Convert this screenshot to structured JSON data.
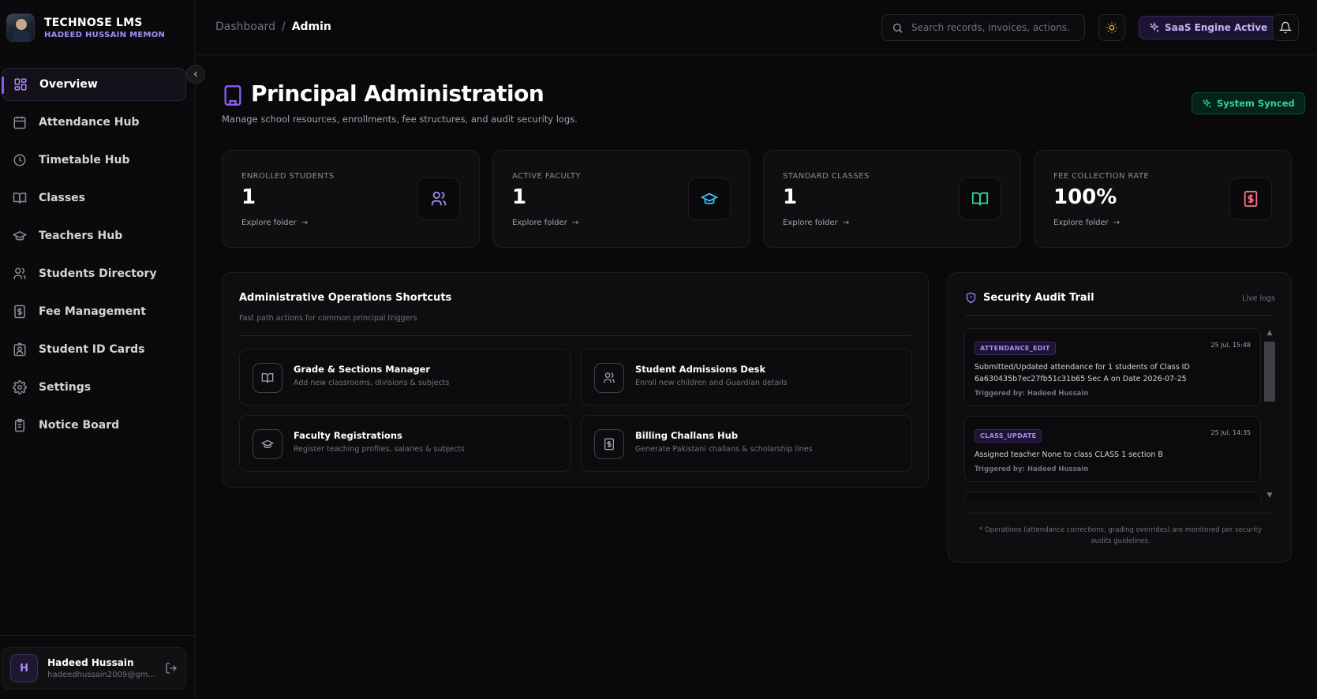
{
  "brand": {
    "title": "TECHNOSE LMS",
    "subtitle": "HADEED HUSSAIN MEMON"
  },
  "sidebar": {
    "items": [
      {
        "label": "Overview",
        "icon": "dashboard-icon",
        "active": true
      },
      {
        "label": "Attendance Hub",
        "icon": "calendar-icon"
      },
      {
        "label": "Timetable Hub",
        "icon": "clock-icon"
      },
      {
        "label": "Classes",
        "icon": "book-open-icon"
      },
      {
        "label": "Teachers Hub",
        "icon": "graduation-cap-icon"
      },
      {
        "label": "Students Directory",
        "icon": "users-icon"
      },
      {
        "label": "Fee Management",
        "icon": "receipt-icon"
      },
      {
        "label": "Student ID Cards",
        "icon": "id-badge-icon"
      },
      {
        "label": "Settings",
        "icon": "gear-icon"
      },
      {
        "label": "Notice Board",
        "icon": "clipboard-icon"
      }
    ],
    "user": {
      "initial": "H",
      "name": "Hadeed Hussain",
      "email": "hadeedhussain2009@gm..."
    }
  },
  "header": {
    "breadcrumb": [
      "Dashboard",
      "/",
      "Admin"
    ],
    "search_placeholder": "Search records, invoices, actions...",
    "saas_badge": "SaaS Engine Active"
  },
  "page": {
    "title": "Principal Administration",
    "description": "Manage school resources, enrollments, fee structures, and audit security logs.",
    "sync_badge": "System Synced"
  },
  "stats": [
    {
      "label": "ENROLLED STUDENTS",
      "value": "1",
      "link": "Explore folder",
      "icon": "users-icon",
      "color": "#a78bfa"
    },
    {
      "label": "ACTIVE FACULTY",
      "value": "1",
      "link": "Explore folder",
      "icon": "graduation-cap-icon",
      "color": "#38bdf8"
    },
    {
      "label": "STANDARD CLASSES",
      "value": "1",
      "link": "Explore folder",
      "icon": "book-open-icon",
      "color": "#34d399"
    },
    {
      "label": "FEE COLLECTION RATE",
      "value": "100%",
      "link": "Explore folder",
      "icon": "receipt-icon",
      "color": "#fb7185"
    }
  ],
  "shortcuts": {
    "title": "Administrative Operations Shortcuts",
    "subtitle": "Fast path actions for common principal triggers",
    "items": [
      {
        "title": "Grade & Sections Manager",
        "desc": "Add new classrooms, divisions & subjects",
        "icon": "book-open-icon"
      },
      {
        "title": "Student Admissions Desk",
        "desc": "Enroll new children and Guardian details",
        "icon": "users-icon"
      },
      {
        "title": "Faculty Registrations",
        "desc": "Register teaching profiles, salaries & subjects",
        "icon": "graduation-cap-icon"
      },
      {
        "title": "Billing Challans Hub",
        "desc": "Generate Pakistani challans & scholarship lines",
        "icon": "receipt-icon"
      }
    ]
  },
  "audit": {
    "title": "Security Audit Trail",
    "live_label": "Live logs",
    "logs": [
      {
        "tag": "ATTENDANCE_EDIT",
        "time": "25 Jul, 15:48",
        "text": "Submitted/Updated attendance for 1 students of Class ID 6a630435b7ec27fb51c31b65 Sec A on Date 2026-07-25",
        "trigger": "Triggered by: Hadeed Hussain"
      },
      {
        "tag": "CLASS_UPDATE",
        "time": "25 Jul, 14:35",
        "text": "Assigned teacher None to class CLASS 1 section B",
        "trigger": "Triggered by: Hadeed Hussain"
      }
    ],
    "footnote": "* Operations (attendance corrections, grading overrides) are monitored per security audits guidelines."
  },
  "colors": {
    "accent": "#8b5cf6",
    "success": "#34d399",
    "background": "#09090b"
  }
}
